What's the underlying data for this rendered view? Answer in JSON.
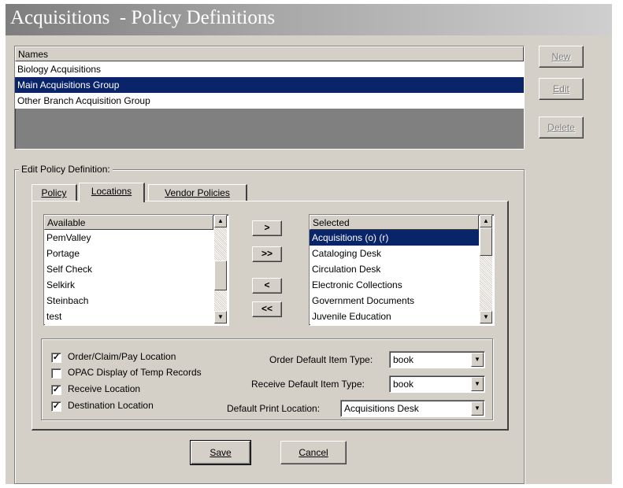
{
  "window": {
    "title": "Acquisitions  - Policy Definitions"
  },
  "names": {
    "header": "Names",
    "rows": [
      "Biology Acquisitions",
      "Main Acquisitions Group",
      "Other Branch Acquisition Group"
    ],
    "selected_index": 1
  },
  "side_buttons": {
    "new_label": "New",
    "edit_label": "Edit",
    "delete_label": "Delete"
  },
  "edit_group": {
    "label": "Edit  Policy Definition:"
  },
  "tabs": [
    {
      "label": "Policy",
      "active": false
    },
    {
      "label": "Locations",
      "active": true
    },
    {
      "label": "Vendor Policies",
      "active": false
    }
  ],
  "available": {
    "header": "Available",
    "items": [
      "PemValley",
      "Portage",
      "Self Check",
      "Selkirk",
      "Steinbach",
      "test"
    ]
  },
  "selected": {
    "header": "Selected",
    "items": [
      "Acquisitions (o) (r)",
      "Cataloging Desk",
      "Circulation Desk",
      "Electronic Collections",
      "Government Documents",
      "Juvenile Education"
    ],
    "selected_index": 0
  },
  "move_buttons": {
    "add": ">",
    "add_all": ">>",
    "remove": "<",
    "remove_all": "<<"
  },
  "options": {
    "order_claim_pay": {
      "label": "Order/Claim/Pay Location",
      "checked": true
    },
    "opac_display": {
      "label": "OPAC Display of Temp Records",
      "checked": false
    },
    "receive_location": {
      "label": "Receive Location",
      "checked": true
    },
    "destination_location": {
      "label": "Destination Location",
      "checked": true
    }
  },
  "defaults": {
    "order_item_type": {
      "label": "Order Default Item Type:",
      "value": "book"
    },
    "receive_item_type": {
      "label": "Receive Default Item Type:",
      "value": "book"
    },
    "print_location": {
      "label": "Default Print Location:",
      "value": "Acquisitions Desk"
    }
  },
  "footer": {
    "save_label": "Save",
    "cancel_label": "Cancel"
  },
  "check_glyph": "✓",
  "icons": {
    "scroll_up": "scroll-up-arrow",
    "scroll_down": "scroll-down-arrow",
    "dropdown": "dropdown-arrow"
  }
}
